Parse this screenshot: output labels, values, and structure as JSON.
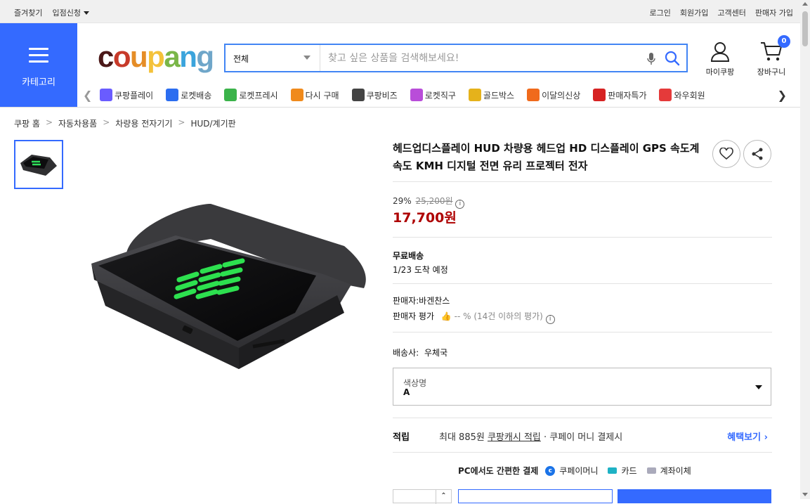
{
  "topbar": {
    "left": [
      "즐겨찾기",
      "입점신청"
    ],
    "right": [
      "로그인",
      "회원가입",
      "고객센터",
      "판매자 가입"
    ]
  },
  "header": {
    "category_label": "카테고리",
    "logo": {
      "letters": [
        "c",
        "o",
        "u",
        "p",
        "a",
        "n",
        "g"
      ],
      "colors": [
        "#4b1818",
        "#c73a2a",
        "#e58d27",
        "#f4c23a",
        "#7ab648",
        "#3ba4dc",
        "#6fa6c9"
      ]
    },
    "search": {
      "scope": "전체",
      "placeholder": "찾고 싶은 상품을 검색해보세요!"
    },
    "mypage_label": "마이쿠팡",
    "cart_label": "장바구니",
    "cart_count": "0"
  },
  "nav": {
    "items": [
      {
        "label": "쿠팡플레이",
        "icon": "play-icon",
        "color": "#6a5cff"
      },
      {
        "label": "로켓배송",
        "icon": "rocket-icon",
        "color": "#2b6df0"
      },
      {
        "label": "로켓프레시",
        "icon": "rocket-fresh-icon",
        "color": "#3bb34a"
      },
      {
        "label": "다시 구매",
        "icon": "rebuy-icon",
        "color": "#f08a1c"
      },
      {
        "label": "쿠팡비즈",
        "icon": "biz-icon",
        "color": "#444444"
      },
      {
        "label": "로켓직구",
        "icon": "rocket-global-icon",
        "color": "#b94dd9"
      },
      {
        "label": "골드박스",
        "icon": "goldbox-icon",
        "color": "#e5b21b"
      },
      {
        "label": "이달의신상",
        "icon": "new-bag-icon",
        "color": "#f06a1c"
      },
      {
        "label": "판매자특가",
        "icon": "percent-icon",
        "color": "#d62222"
      },
      {
        "label": "와우회원",
        "icon": "wow-icon",
        "color": "#e53a3a"
      }
    ]
  },
  "breadcrumb": [
    "쿠팡 홈",
    "자동차용품",
    "차량용 전자기기",
    "HUD/계기판"
  ],
  "product": {
    "title": "헤드업디스플레이 HUD 차량용 헤드업 HD 디스플레이 GPS 속도계 속도 KMH 디지털 전면 유리 프로젝터 전자",
    "discount": "29%",
    "original_price": "25,200원",
    "price": "17,700원",
    "shipping_label": "무료배송",
    "arrival": "1/23 도착 예정",
    "seller": "판매자:바겐찬스",
    "seller_rating_label": "판매자 평가",
    "seller_rating_value": "-- % (14건 이하의 평가)",
    "carrier_label": "배송사:",
    "carrier": "우체국",
    "option_name": "색상명",
    "option_value": "A",
    "reward_label": "적립",
    "reward_desc_1": "최대 885원",
    "reward_link": "쿠팡캐시 적립",
    "reward_desc_2": "· 쿠페이 머니 결제시",
    "reward_more": "혜택보기",
    "pay_title": "PC에서도 간편한 결제",
    "pay_methods": [
      "쿠페이머니",
      "카드",
      "계좌이체"
    ]
  }
}
